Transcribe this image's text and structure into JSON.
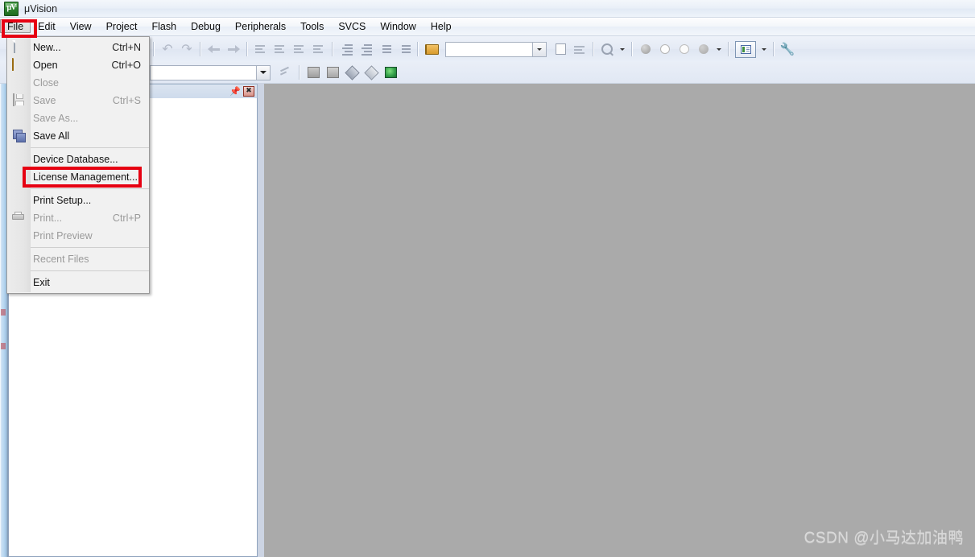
{
  "window": {
    "title": "μVision",
    "app_icon": "uvision-logo-icon"
  },
  "menubar": {
    "items": [
      {
        "label": "File",
        "selected": true
      },
      {
        "label": "Edit",
        "selected": false
      },
      {
        "label": "View",
        "selected": false
      },
      {
        "label": "Project",
        "selected": false
      },
      {
        "label": "Flash",
        "selected": false
      },
      {
        "label": "Debug",
        "selected": false
      },
      {
        "label": "Peripherals",
        "selected": false
      },
      {
        "label": "Tools",
        "selected": false
      },
      {
        "label": "SVCS",
        "selected": false
      },
      {
        "label": "Window",
        "selected": false
      },
      {
        "label": "Help",
        "selected": false
      }
    ]
  },
  "file_menu": {
    "items": [
      {
        "label": "New...",
        "accel": "Ctrl+N",
        "icon": "new-file-icon",
        "disabled": false
      },
      {
        "label": "Open",
        "accel": "Ctrl+O",
        "icon": "open-folder-icon",
        "disabled": false
      },
      {
        "label": "Close",
        "accel": "",
        "icon": "",
        "disabled": true
      },
      {
        "label": "Save",
        "accel": "Ctrl+S",
        "icon": "save-disk-icon",
        "disabled": true
      },
      {
        "label": "Save As...",
        "accel": "",
        "icon": "",
        "disabled": true
      },
      {
        "label": "Save All",
        "accel": "",
        "icon": "save-all-icon",
        "disabled": false
      },
      {
        "separator": true
      },
      {
        "label": "Device Database...",
        "accel": "",
        "icon": "",
        "disabled": false
      },
      {
        "label": "License Management...",
        "accel": "",
        "icon": "",
        "disabled": false,
        "highlighted": true
      },
      {
        "separator": true
      },
      {
        "label": "Print Setup...",
        "accel": "",
        "icon": "",
        "disabled": false
      },
      {
        "label": "Print...",
        "accel": "Ctrl+P",
        "icon": "printer-icon",
        "disabled": true
      },
      {
        "label": "Print Preview",
        "accel": "",
        "icon": "",
        "disabled": true
      },
      {
        "separator": true
      },
      {
        "label": "Recent Files",
        "accel": "",
        "icon": "",
        "disabled": true
      },
      {
        "separator": true
      },
      {
        "label": "Exit",
        "accel": "",
        "icon": "",
        "disabled": false
      }
    ]
  },
  "toolbar_row1": {
    "buttons": [
      {
        "name": "undo-button",
        "glyph": "↶"
      },
      {
        "name": "redo-button",
        "glyph": "↷"
      },
      {
        "name": "back-navigate-button",
        "glyph": "←"
      },
      {
        "name": "forward-navigate-button",
        "glyph": "→"
      },
      {
        "name": "toggle-bookmark-button",
        "glyph": "bookmark"
      },
      {
        "name": "previous-bookmark-button",
        "glyph": "bookmark-prev"
      },
      {
        "name": "next-bookmark-button",
        "glyph": "bookmark-next"
      },
      {
        "name": "clear-bookmarks-button",
        "glyph": "bookmark-clear"
      },
      {
        "name": "indent-button",
        "glyph": "indent-right"
      },
      {
        "name": "outdent-button",
        "glyph": "indent-left"
      },
      {
        "name": "comment-lines-button",
        "glyph": "comment"
      },
      {
        "name": "uncomment-lines-button",
        "glyph": "uncomment"
      },
      {
        "name": "open-project-button",
        "glyph": "folder"
      }
    ]
  },
  "toolbar_row2": {
    "search_value": "",
    "search_placeholder": "",
    "target_value": "",
    "target_placeholder": "",
    "buttons": [
      {
        "name": "configuration-wizard-button"
      },
      {
        "name": "build-button"
      },
      {
        "name": "rebuild-button"
      },
      {
        "name": "batch-build-button"
      },
      {
        "name": "translate-button"
      },
      {
        "name": "target-options-button"
      },
      {
        "name": "file-info-button"
      },
      {
        "name": "manage-components-button"
      },
      {
        "name": "find-in-files-button"
      },
      {
        "name": "insert-breakpoint-button"
      },
      {
        "name": "kill-breakpoint-button"
      },
      {
        "name": "disable-breakpoint-button"
      },
      {
        "name": "kill-all-breakpoints-button"
      },
      {
        "name": "window-layout-button"
      },
      {
        "name": "configure-tools-button"
      }
    ]
  },
  "left_panel": {
    "caption_buttons": [
      {
        "name": "pin-button",
        "glyph": "📌"
      },
      {
        "name": "close-panel-button",
        "glyph": "✕"
      }
    ]
  },
  "annotations": [
    {
      "name": "annotation-file-menu",
      "target": "File"
    },
    {
      "name": "annotation-license-management",
      "target": "License Management..."
    }
  ],
  "watermark": {
    "text": "CSDN @小马达加油鸭"
  },
  "colors": {
    "annotation_red": "#e60012",
    "workspace_gray": "#aaaaaa",
    "titlebar": "#eaf0f8",
    "menu_popup_bg": "#f1f1f1"
  }
}
